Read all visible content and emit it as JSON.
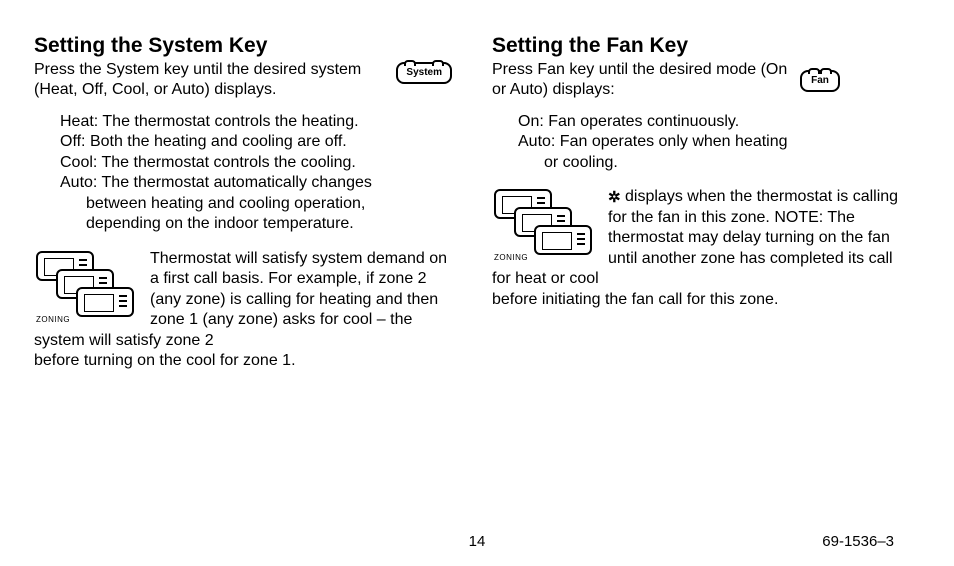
{
  "left": {
    "heading": "Setting the System Key",
    "intro": "Press the System key until the desired system (Heat, Off, Cool, or Auto) displays.",
    "key_label": "System",
    "defs": {
      "heat": "Heat: The thermostat controls the heating.",
      "off": "Off: Both the heating and cooling are off.",
      "cool": "Cool: The thermostat controls the cooling.",
      "auto1": "Auto: The thermostat automatically changes",
      "auto2": "between heating and cooling operation,",
      "auto3": "depending on the indoor temperature."
    },
    "zone_text_a": "Thermostat will satisfy system demand on a first call basis. For example, if zone 2 (any zone) is calling for heating and then zone 1 (any zone) asks for cool – the system will satisfy zone 2",
    "zone_text_b": "before turning on the cool for zone 1.",
    "zoning_label": "ZONING"
  },
  "right": {
    "heading": "Setting the Fan Key",
    "intro": "Press Fan key until the desired mode (On or Auto) displays:",
    "key_label": "Fan",
    "defs": {
      "on": "On: Fan operates continuously.",
      "auto1": "Auto: Fan operates only when heating",
      "auto2": "or cooling."
    },
    "fan_symbol": "✲",
    "zone_text_a": " displays when the thermostat is calling for the fan in this zone. NOTE: The thermostat may delay turning on the fan until another zone has completed its call for heat or cool",
    "zone_text_b": "before initiating the fan call for this zone.",
    "zoning_label": "ZONING"
  },
  "footer": {
    "page": "14",
    "doc": "69-1536–3"
  }
}
